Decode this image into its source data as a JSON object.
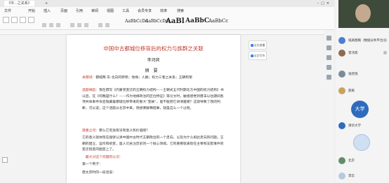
{
  "window": {
    "tab_title": "《中...之关系》",
    "new_tab": "+"
  },
  "menu": {
    "items": [
      "文件",
      "开始",
      "插入",
      "页面",
      "引用",
      "审阅",
      "视图",
      "工具",
      "会员专享",
      "效率",
      "搜索"
    ]
  },
  "ribbon": {
    "styles": [
      "AaBbCcDd",
      "AaBbCcDd",
      "AaBl",
      "AaBbC",
      "AaBbCc"
    ]
  },
  "document": {
    "title": "中国中古都城位移背后的权力与族群之关联",
    "author": "李鸿宾",
    "abstract_heading": "摘要",
    "paragraphs": [
      {
        "lead": "关键词：",
        "text": "都城两-东-北向的转移；地缘；人群；权力三者之关系；王朝构架"
      },
      {
        "lead": "选题缘起：",
        "text": "我在撰写《内蒙突变迁的王朝权力结构——王朝式五代时期北方中国的权力结构》书以后，在《何晚是什么？——作为地缘政治的区位特征》等论文时，触感感觉到唐末以往期间各项共体事件背后隐藏着都城位移带来的重大“变故”，能不能把它讲清楚呢？这就导致了我的判断，可以说，这个话题从北京中来，则想要解释结果，就是这么一个过程。"
      },
      {
        "lead": "思路之问：",
        "text": "那么它究竟有没有意义和价值呢？"
      },
      {
        "lead": "",
        "text": "它的意义就体现在能够认清中国中古时代王朝政治的一个走向，以及为什么如此走向的问题。王朝的建立、运作和统变，是人们关注历史的一个核心领域，它的重要就表现在主宰和支配事件的变迁程度的趋势上了。"
      },
      {
        "lead": "",
        "text": "　最大对这个问题的认识："
      },
      {
        "lead": "",
        "text": "第一个例子："
      },
      {
        "lead": "",
        "text": "唐太宗时的一段话说："
      }
    ]
  },
  "side_buttons": [
    "论文查重",
    "论文写作"
  ],
  "meeting": {
    "participants": [
      {
        "name": "纸质图稿（数据分析平台）",
        "color": "#4a7fd1"
      },
      {
        "name": "李鸿宾",
        "color": "#8e6c52"
      },
      {
        "name": "张欣悦",
        "color": "#7a8b99"
      },
      {
        "name": "薛爽",
        "color": "#c9a25e"
      },
      {
        "name": "北京",
        "color": "#5f8f6a"
      },
      {
        "name": "清华大学",
        "color": "#2f6bbd"
      },
      {
        "name": "李云",
        "color": "#b7c9de"
      }
    ],
    "badge": "大学"
  }
}
